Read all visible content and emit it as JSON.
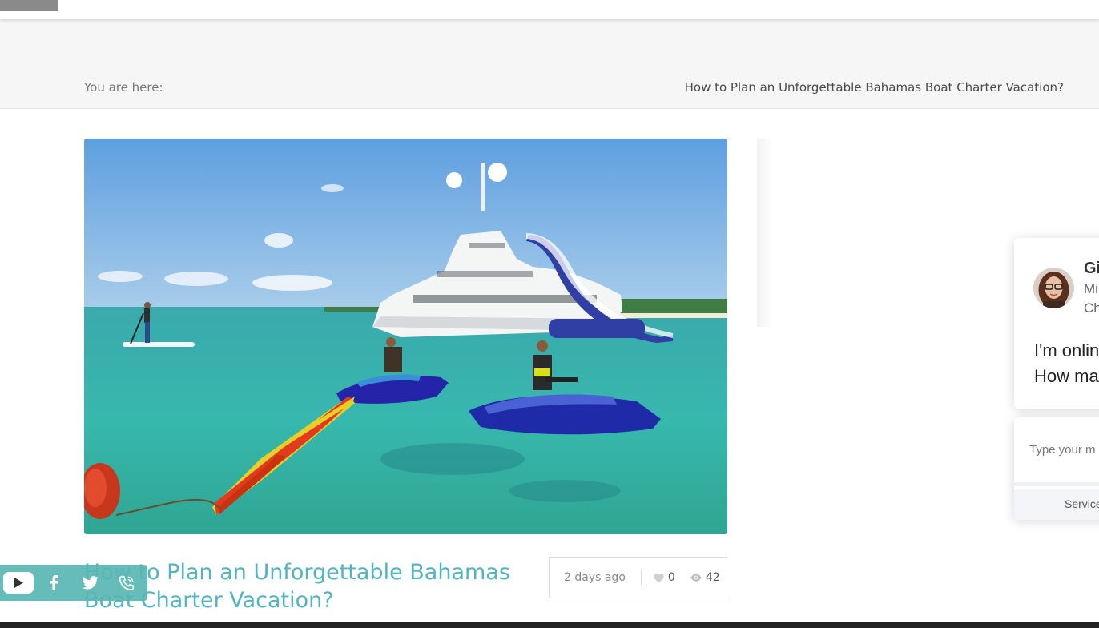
{
  "breadcrumb": {
    "label": "You are here:",
    "current": "How to Plan an Unforgettable Bahamas Boat Charter Vacation?"
  },
  "post": {
    "title": "How to Plan an Unforgettable Bahamas Boat Charter Vacation?",
    "date": "2 days ago",
    "likes": "0",
    "views": "42"
  },
  "social": {
    "items": [
      "youtube-icon",
      "facebook-icon",
      "twitter-icon",
      "phone-icon"
    ]
  },
  "chat": {
    "name": "Gi",
    "role_line1": "Mi",
    "role_line2": "Ch",
    "message_line1": "I'm onlin",
    "message_line2": "How ma",
    "input_placeholder": "Type your m",
    "footer": "Service"
  },
  "colors": {
    "accent": "#4fb5c0",
    "social_bar": "#5ab7b3",
    "breadcrumb_bg": "#f6f6f6"
  }
}
